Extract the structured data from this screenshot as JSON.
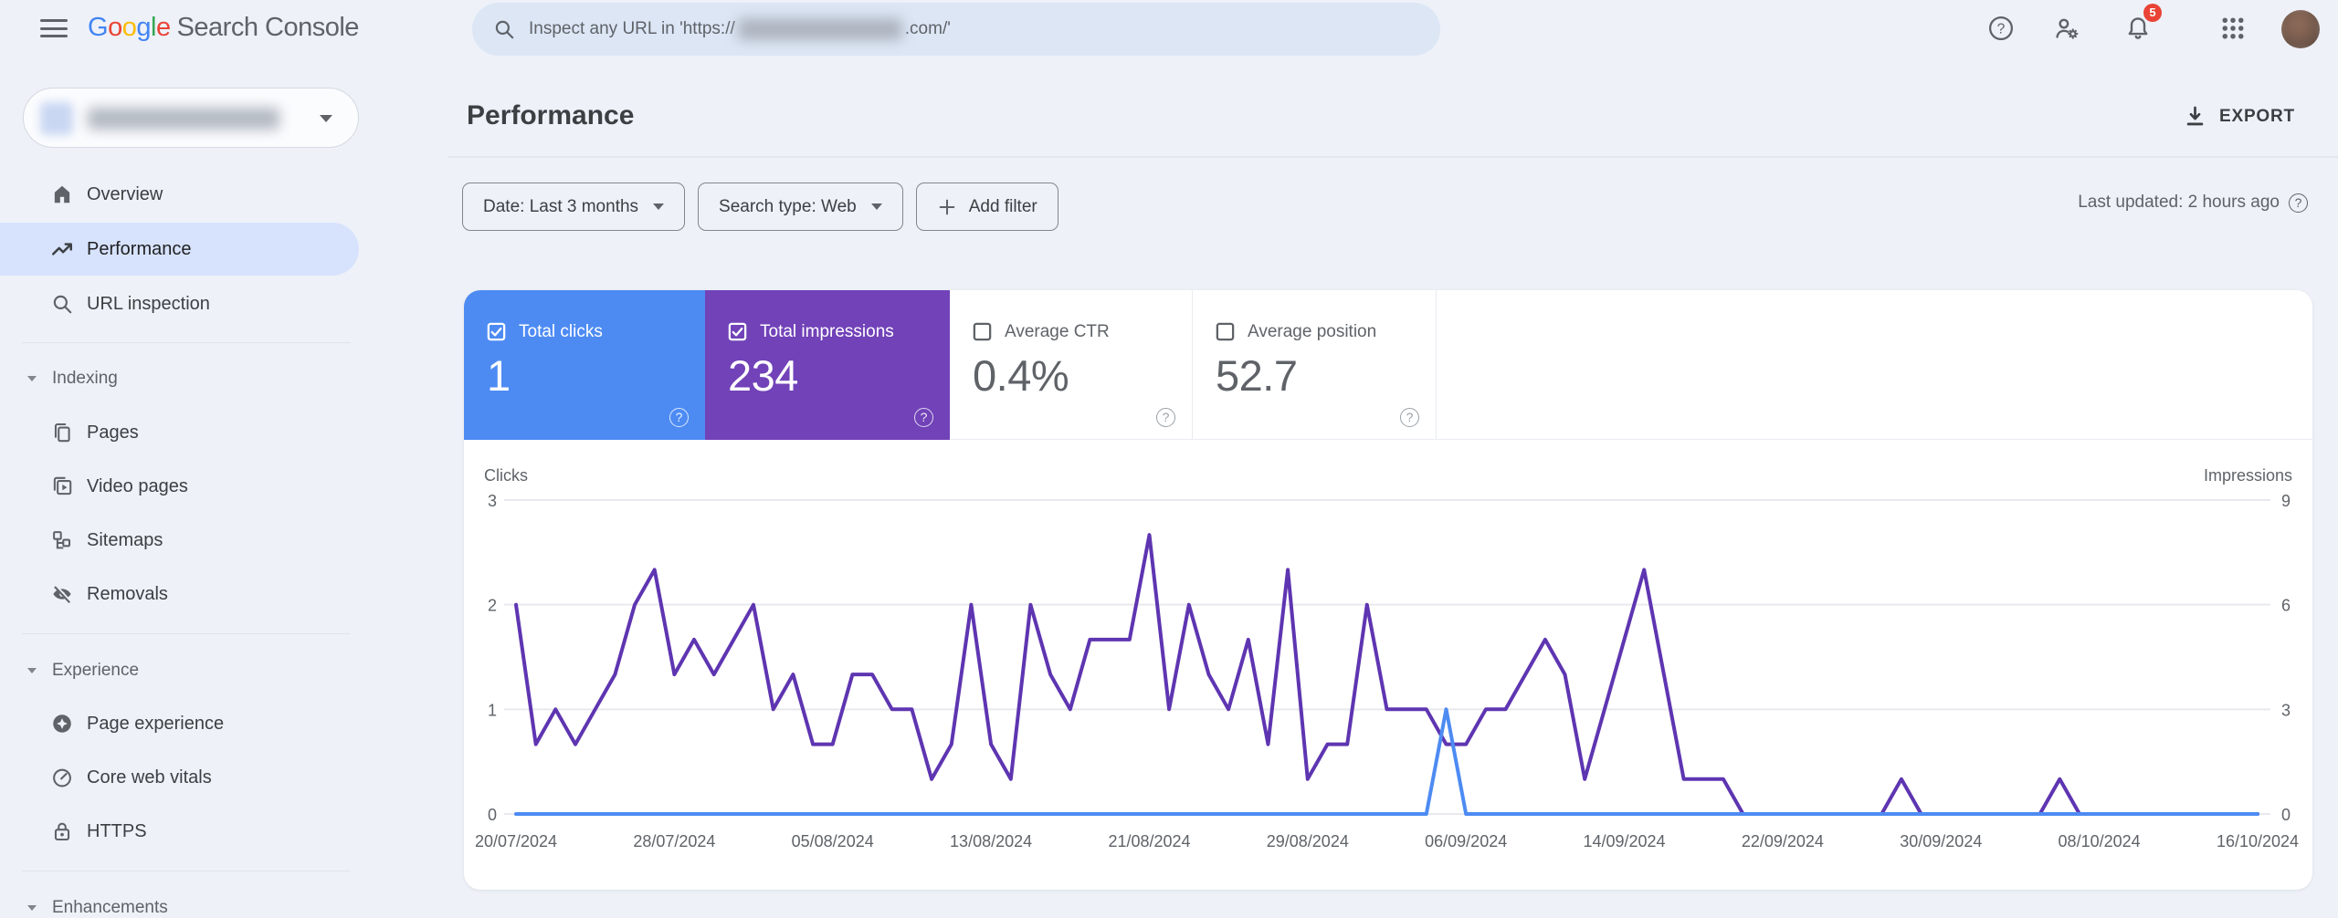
{
  "topbar": {
    "logo_letters": [
      "G",
      "o",
      "o",
      "g",
      "l",
      "e"
    ],
    "logo_rest": "Search Console",
    "search": {
      "placeholder_prefix": "Inspect any URL in 'https://",
      "placeholder_suffix": ".com/'"
    },
    "notification_count": "5"
  },
  "icons": {
    "help_glyph": "?"
  },
  "sidebar": {
    "items": [
      {
        "label": "Overview"
      },
      {
        "label": "Performance",
        "active": true
      },
      {
        "label": "URL inspection"
      }
    ],
    "sections": [
      {
        "label": "Indexing",
        "items": [
          {
            "label": "Pages"
          },
          {
            "label": "Video pages"
          },
          {
            "label": "Sitemaps"
          },
          {
            "label": "Removals"
          }
        ]
      },
      {
        "label": "Experience",
        "items": [
          {
            "label": "Page experience"
          },
          {
            "label": "Core web vitals"
          },
          {
            "label": "HTTPS"
          }
        ]
      },
      {
        "label": "Enhancements",
        "items": []
      }
    ]
  },
  "header": {
    "title": "Performance",
    "export_label": "EXPORT",
    "last_updated": "Last updated: 2 hours ago"
  },
  "filters": {
    "date": "Date: Last 3 months",
    "search_type": "Search type: Web",
    "add_filter": "Add filter"
  },
  "cards": [
    {
      "label": "Total clicks",
      "value": "1",
      "checked": true,
      "color": "#4d8bf3"
    },
    {
      "label": "Total impressions",
      "value": "234",
      "checked": true,
      "color": "#7142b8"
    },
    {
      "label": "Average CTR",
      "value": "0.4%",
      "checked": false,
      "color": "#ffffff"
    },
    {
      "label": "Average position",
      "value": "52.7",
      "checked": false,
      "color": "#ffffff"
    }
  ],
  "chart_data": {
    "type": "line",
    "x_start": "20/07/2024",
    "x_end": "16/10/2024",
    "points": "daily",
    "x_tick_labels": [
      "20/07/2024",
      "28/07/2024",
      "05/08/2024",
      "13/08/2024",
      "21/08/2024",
      "29/08/2024",
      "06/09/2024",
      "14/09/2024",
      "22/09/2024",
      "30/09/2024",
      "08/10/2024",
      "16/10/2024"
    ],
    "x_tick_every": 8,
    "left_axis": {
      "label": "Clicks",
      "ticks": [
        0,
        1,
        2,
        3
      ],
      "max": 3
    },
    "right_axis": {
      "label": "Impressions",
      "ticks": [
        0,
        3,
        6,
        9
      ],
      "max": 9
    },
    "grid": "horizontal",
    "legend_position": "none",
    "series": [
      {
        "name": "Clicks",
        "axis": "left",
        "color": "#4d8bf3",
        "values": [
          0,
          0,
          0,
          0,
          0,
          0,
          0,
          0,
          0,
          0,
          0,
          0,
          0,
          0,
          0,
          0,
          0,
          0,
          0,
          0,
          0,
          0,
          0,
          0,
          0,
          0,
          0,
          0,
          0,
          0,
          0,
          0,
          0,
          0,
          0,
          0,
          0,
          0,
          0,
          0,
          0,
          0,
          0,
          0,
          0,
          0,
          0,
          1,
          0,
          0,
          0,
          0,
          0,
          0,
          0,
          0,
          0,
          0,
          0,
          0,
          0,
          0,
          0,
          0,
          0,
          0,
          0,
          0,
          0,
          0,
          0,
          0,
          0,
          0,
          0,
          0,
          0,
          0,
          0,
          0,
          0,
          0,
          0,
          0,
          0,
          0,
          0,
          0,
          0
        ]
      },
      {
        "name": "Impressions",
        "axis": "right",
        "color": "#5e35b1",
        "values": [
          6,
          2,
          3,
          2,
          3,
          4,
          6,
          7,
          4,
          5,
          4,
          5,
          6,
          3,
          4,
          2,
          2,
          4,
          4,
          3,
          3,
          1,
          2,
          6,
          2,
          1,
          6,
          4,
          3,
          5,
          5,
          5,
          8,
          3,
          6,
          4,
          3,
          5,
          2,
          7,
          1,
          2,
          2,
          6,
          3,
          3,
          3,
          2,
          2,
          3,
          3,
          4,
          5,
          4,
          1,
          3,
          5,
          7,
          4,
          1,
          1,
          1,
          0,
          0,
          0,
          0,
          0,
          0,
          0,
          0,
          1,
          0,
          0,
          0,
          0,
          0,
          0,
          0,
          1,
          0,
          0,
          0,
          0,
          0,
          0,
          0,
          0,
          0,
          0
        ]
      }
    ]
  }
}
